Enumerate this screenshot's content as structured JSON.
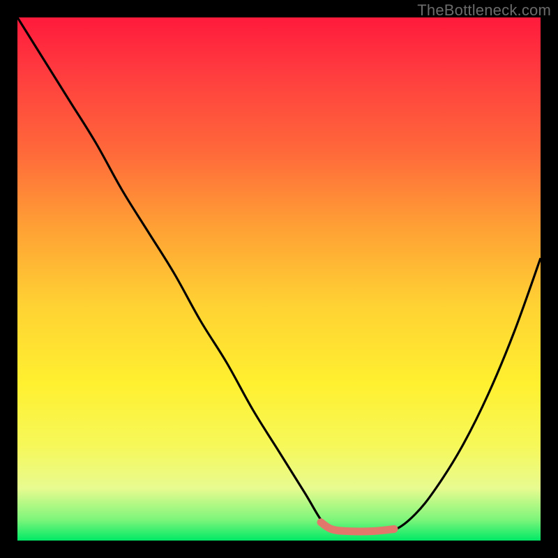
{
  "watermark": "TheBottleneck.com",
  "chart_data": {
    "type": "line",
    "title": "",
    "xlabel": "",
    "ylabel": "",
    "xlim": [
      0,
      100
    ],
    "ylim": [
      0,
      100
    ],
    "series": [
      {
        "name": "black-curve",
        "color": "#000000",
        "x": [
          0,
          5,
          10,
          15,
          20,
          25,
          30,
          35,
          40,
          45,
          50,
          55,
          58,
          60,
          63,
          68,
          72,
          76,
          80,
          85,
          90,
          95,
          100
        ],
        "y": [
          100,
          92,
          84,
          76,
          67,
          59,
          51,
          42,
          34,
          25,
          17,
          9,
          4,
          2,
          1.5,
          1.5,
          2,
          5,
          10,
          18,
          28,
          40,
          54
        ]
      },
      {
        "name": "highlight-band",
        "color": "#e2776c",
        "x": [
          58,
          60,
          63,
          68,
          72
        ],
        "y": [
          3.5,
          2.2,
          1.8,
          1.8,
          2.2
        ]
      }
    ],
    "gradient_stops": [
      {
        "pos": 0,
        "color": "#ff1a3c"
      },
      {
        "pos": 26,
        "color": "#ff6a3a"
      },
      {
        "pos": 55,
        "color": "#ffd233"
      },
      {
        "pos": 82,
        "color": "#f6f85a"
      },
      {
        "pos": 96,
        "color": "#7df57a"
      },
      {
        "pos": 100,
        "color": "#00e966"
      }
    ]
  }
}
